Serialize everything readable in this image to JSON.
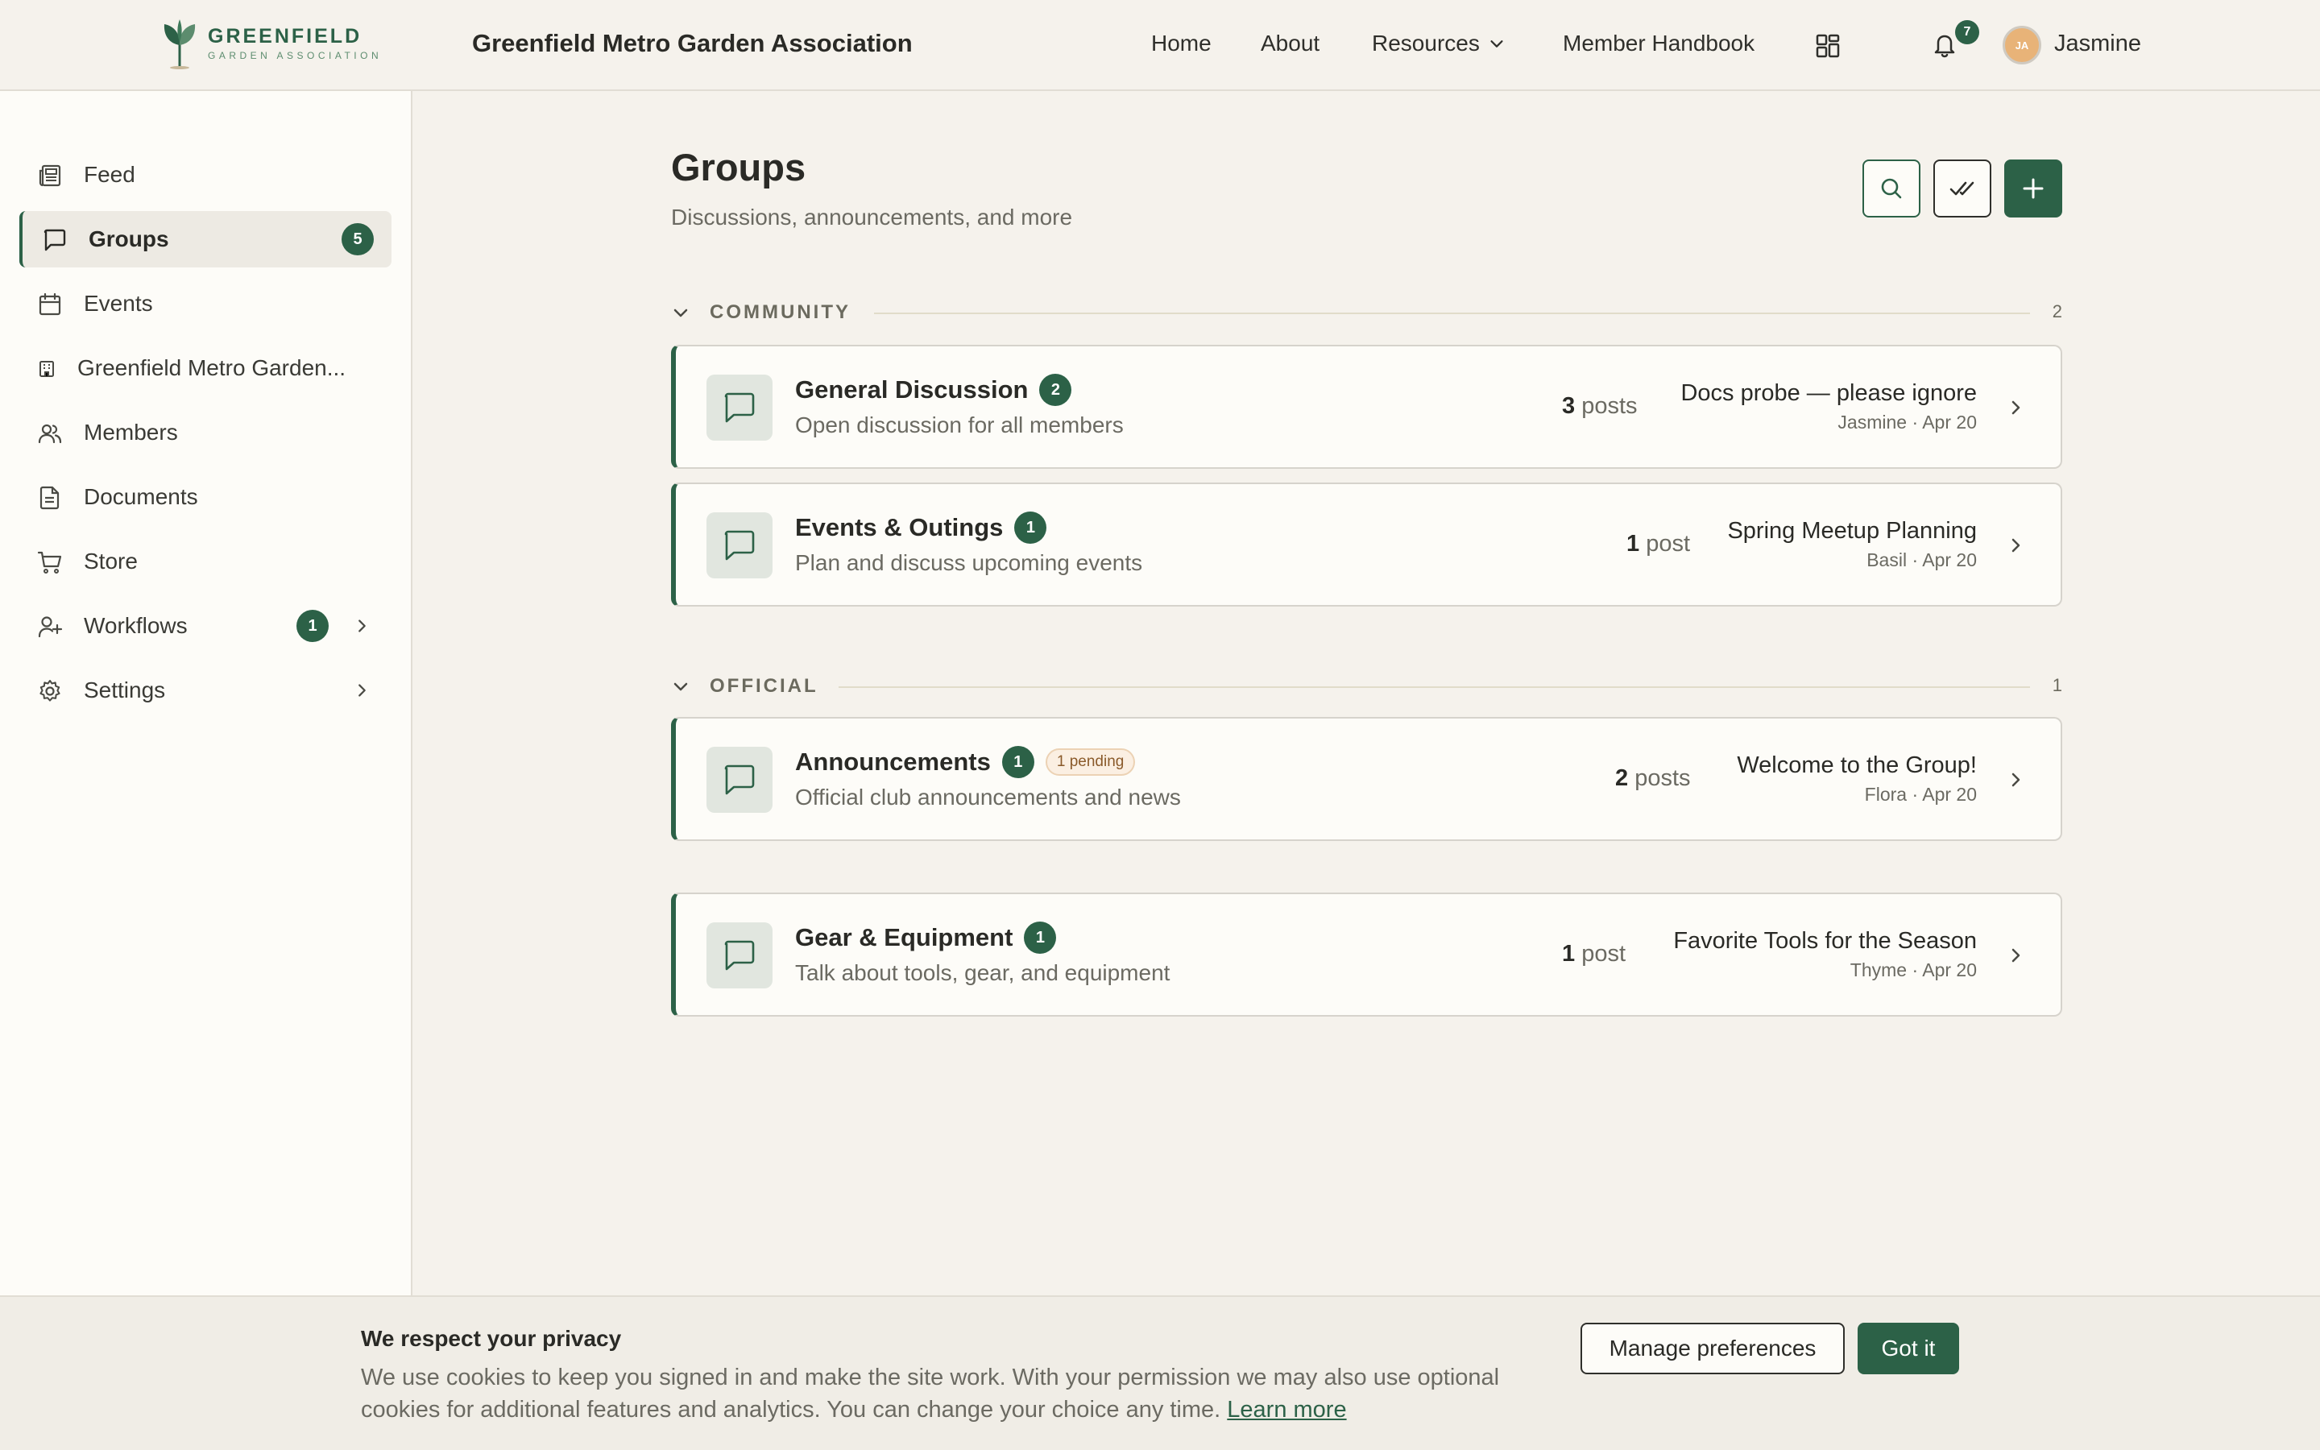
{
  "header": {
    "logo_name": "GREENFIELD",
    "logo_sub": "GARDEN ASSOCIATION",
    "org_title": "Greenfield Metro Garden Association",
    "nav": {
      "home": "Home",
      "about": "About",
      "resources": "Resources",
      "handbook": "Member Handbook"
    },
    "notification_count": "7",
    "user_initials": "JA",
    "user_name": "Jasmine"
  },
  "sidebar": {
    "items": [
      {
        "label": "Feed",
        "icon": "newspaper-icon"
      },
      {
        "label": "Groups",
        "icon": "chat-icon",
        "badge": "5",
        "active": true
      },
      {
        "label": "Events",
        "icon": "calendar-icon"
      },
      {
        "label": "Greenfield Metro Garden...",
        "icon": "building-icon"
      },
      {
        "label": "Members",
        "icon": "users-icon"
      },
      {
        "label": "Documents",
        "icon": "document-icon"
      },
      {
        "label": "Store",
        "icon": "cart-icon"
      },
      {
        "label": "Workflows",
        "icon": "user-plus-icon",
        "badge": "1"
      },
      {
        "label": "Settings",
        "icon": "gear-icon"
      }
    ]
  },
  "page": {
    "title": "Groups",
    "subtitle": "Discussions, announcements, and more"
  },
  "sections": [
    {
      "name": "COMMUNITY",
      "count": "2",
      "groups": [
        {
          "name": "General Discussion",
          "badge": "2",
          "description": "Open discussion for all members",
          "post_count": "3",
          "post_label": "posts",
          "latest_title": "Docs probe — please ignore",
          "latest_meta": "Jasmine · Apr 20"
        },
        {
          "name": "Events & Outings",
          "badge": "1",
          "description": "Plan and discuss upcoming events",
          "post_count": "1",
          "post_label": "post",
          "latest_title": "Spring Meetup Planning",
          "latest_meta": "Basil · Apr 20"
        }
      ]
    },
    {
      "name": "OFFICIAL",
      "count": "1",
      "groups": [
        {
          "name": "Announcements",
          "badge": "1",
          "pending": "1 pending",
          "description": "Official club announcements and news",
          "post_count": "2",
          "post_label": "posts",
          "latest_title": "Welcome to the Group!",
          "latest_meta": "Flora · Apr 20"
        }
      ]
    }
  ],
  "ungrouped": [
    {
      "name": "Gear & Equipment",
      "badge": "1",
      "description": "Talk about tools, gear, and equipment",
      "post_count": "1",
      "post_label": "post",
      "latest_title": "Favorite Tools for the Season",
      "latest_meta": "Thyme · Apr 20"
    }
  ],
  "cookie": {
    "title": "We respect your privacy",
    "body": "We use cookies to keep you signed in and make the site work. With your permission we may also use optional cookies for additional features and analytics. You can change your choice any time.",
    "learn_more": "Learn more",
    "manage": "Manage preferences",
    "accept": "Got it"
  },
  "colors": {
    "brand": "#2c6147",
    "background": "#f5f2ec",
    "surface": "#fdfcf8",
    "pending_bg": "#fbefe2"
  }
}
